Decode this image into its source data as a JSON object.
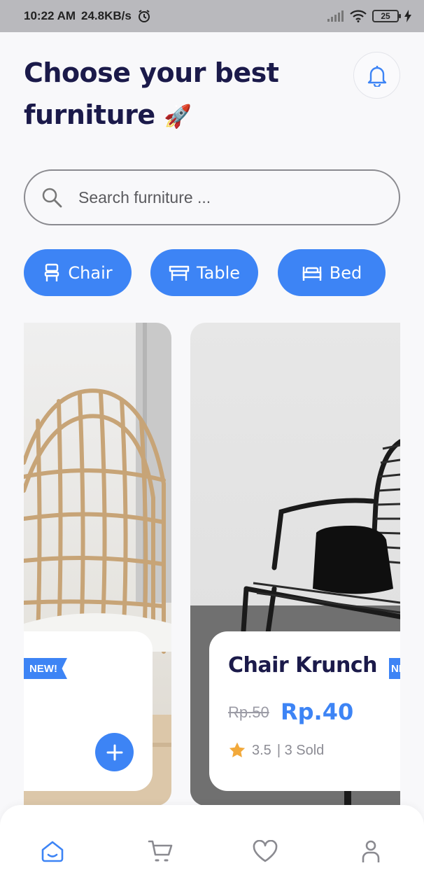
{
  "status_bar": {
    "time": "10:22 AM",
    "speed": "24.8KB/s",
    "battery": "25"
  },
  "header": {
    "title_line1": "Choose your best",
    "title_line2": "furniture",
    "title_emoji": "🚀",
    "bell_icon": "bell-icon"
  },
  "search": {
    "placeholder": "Search furniture ..."
  },
  "categories": [
    {
      "label": "Chair",
      "icon": "chair-icon"
    },
    {
      "label": "Table",
      "icon": "table-icon"
    },
    {
      "label": "Bed",
      "icon": "bed-icon"
    }
  ],
  "products": [
    {
      "badge": "NEW!"
    },
    {
      "name": "Chair Krunch",
      "badge": "NEW!",
      "old_price": "Rp.50",
      "price": "Rp.40",
      "rating": "3.5",
      "sold": "| 3 Sold"
    }
  ],
  "nav": [
    "home-icon",
    "cart-icon",
    "heart-icon",
    "profile-icon"
  ],
  "colors": {
    "accent": "#3d84f5",
    "title": "#1b1a4a",
    "star": "#f2a93b"
  }
}
